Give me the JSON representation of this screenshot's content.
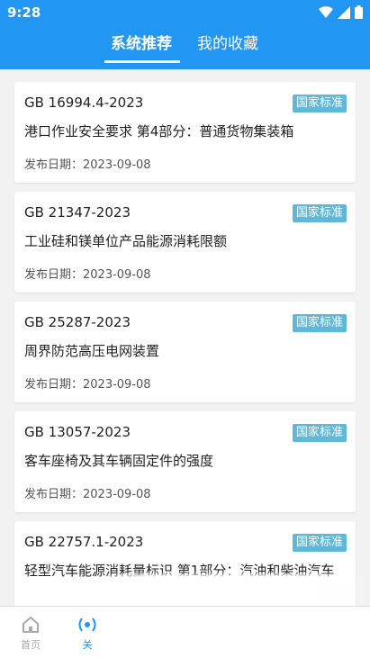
{
  "status_bar": {
    "time": "9:28"
  },
  "tabs": [
    {
      "label": "系统推荐"
    },
    {
      "label": "我的收藏"
    }
  ],
  "cards": [
    {
      "code": "GB 16994.4-2023",
      "badge": "国家标准",
      "title": "港口作业安全要求 第4部分：普通货物集装箱",
      "date": "发布日期：2023-09-08"
    },
    {
      "code": "GB 21347-2023",
      "badge": "国家标准",
      "title": "工业硅和镁单位产品能源消耗限额",
      "date": "发布日期：2023-09-08"
    },
    {
      "code": "GB 25287-2023",
      "badge": "国家标准",
      "title": "周界防范高压电网装置",
      "date": "发布日期：2023-09-08"
    },
    {
      "code": "GB 13057-2023",
      "badge": "国家标准",
      "title": "客车座椅及其车辆固定件的强度",
      "date": "发布日期：2023-09-08"
    },
    {
      "code": "GB 22757.1-2023",
      "badge": "国家标准",
      "title": "轻型汽车能源消耗量标识 第1部分：汽油和柴油汽车",
      "date": ""
    }
  ],
  "bottom_nav": [
    {
      "label": "首页"
    },
    {
      "label": "关"
    }
  ],
  "colors": {
    "primary": "#2196f3",
    "badge": "#5fb8d9"
  }
}
